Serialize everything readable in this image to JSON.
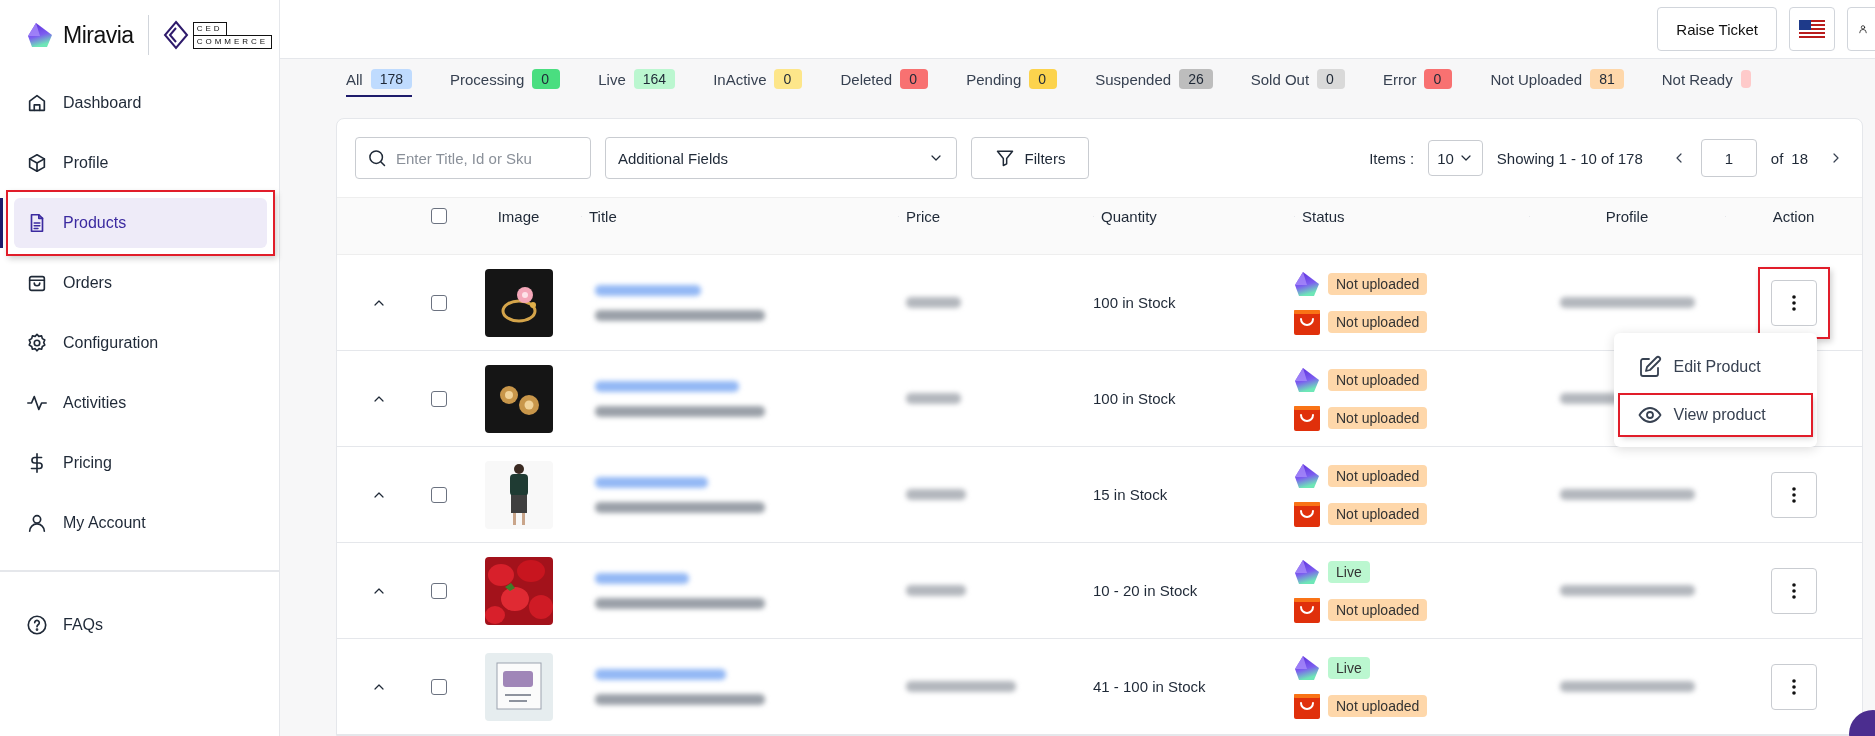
{
  "sidebar": {
    "logo": {
      "brand": "Miravia",
      "partner_top": "CED",
      "partner_bottom": "COMMERCE"
    },
    "items": [
      {
        "label": "Dashboard",
        "selected": false,
        "highlighted": false
      },
      {
        "label": "Profile",
        "selected": false,
        "highlighted": false
      },
      {
        "label": "Products",
        "selected": true,
        "highlighted": true
      },
      {
        "label": "Orders",
        "selected": false,
        "highlighted": false
      },
      {
        "label": "Configuration",
        "selected": false,
        "highlighted": false
      },
      {
        "label": "Activities",
        "selected": false,
        "highlighted": false
      },
      {
        "label": "Pricing",
        "selected": false,
        "highlighted": false
      },
      {
        "label": "My Account",
        "selected": false,
        "highlighted": false
      }
    ],
    "footer_items": [
      {
        "label": "FAQs",
        "selected": false,
        "highlighted": false
      }
    ]
  },
  "header": {
    "buttons": [
      "Raise Ticket"
    ]
  },
  "status_tabs": [
    {
      "label": "All",
      "count": "178",
      "color": "#bfdbfe",
      "selected": true
    },
    {
      "label": "Processing",
      "count": "0",
      "color": "#4ade80",
      "selected": false
    },
    {
      "label": "Live",
      "count": "164",
      "color": "#bbf7d0",
      "selected": false
    },
    {
      "label": "InActive",
      "count": "0",
      "color": "#fde68a",
      "selected": false
    },
    {
      "label": "Deleted",
      "count": "0",
      "color": "#f87171",
      "selected": false
    },
    {
      "label": "Pending",
      "count": "0",
      "color": "#fcd34d",
      "selected": false
    },
    {
      "label": "Suspended",
      "count": "26",
      "color": "#bdbdbd",
      "selected": false
    },
    {
      "label": "Sold Out",
      "count": "0",
      "color": "#d9d9d9",
      "selected": false
    },
    {
      "label": "Error",
      "count": "0",
      "color": "#f87171",
      "selected": false
    },
    {
      "label": "Not Uploaded",
      "count": "81",
      "color": "#fed7aa",
      "selected": false
    },
    {
      "label": "Not Ready",
      "color": "#fecaca",
      "selected": false
    }
  ],
  "toolbar": {
    "search": {
      "placeholder": "Enter Title, Id or Sku"
    },
    "fields_select": "Additional Fields",
    "filters_button": "Filters",
    "items_label": "Items :",
    "items_per_page": "10",
    "showing": "Showing 1 - 10 of 178",
    "page": "1",
    "of_label": "of",
    "total_pages": "18"
  },
  "table": {
    "select_all": {
      "checked": false
    },
    "columns": [
      "Image",
      "Title",
      "Price",
      "Quantity",
      "Status",
      "Profile",
      "Action"
    ],
    "rows": [
      {
        "checked": false,
        "quantity": "100 in Stock",
        "statuses": [
          {
            "kind": "miravia",
            "label": "Not uploaded",
            "color": "#fed7aa"
          },
          {
            "kind": "shop",
            "label": "Not uploaded",
            "color": "#fed7aa"
          }
        ],
        "action_highlighted": true,
        "action_menu": [
          {
            "label": "Edit Product",
            "highlighted": false
          },
          {
            "label": "View product",
            "highlighted": true
          }
        ]
      },
      {
        "checked": false,
        "quantity": "100 in Stock",
        "statuses": [
          {
            "kind": "miravia",
            "label": "Not uploaded",
            "color": "#fed7aa"
          },
          {
            "kind": "shop",
            "label": "Not uploaded",
            "color": "#fed7aa"
          }
        ]
      },
      {
        "checked": false,
        "quantity": "15 in Stock",
        "statuses": [
          {
            "kind": "miravia",
            "label": "Not uploaded",
            "color": "#fed7aa"
          },
          {
            "kind": "shop",
            "label": "Not uploaded",
            "color": "#fed7aa"
          }
        ],
        "action_highlighted": false
      },
      {
        "checked": false,
        "quantity": "10 - 20 in Stock",
        "statuses": [
          {
            "kind": "miravia",
            "label": "Live",
            "color": "#bbf7d0"
          },
          {
            "kind": "shop",
            "label": "Not uploaded",
            "color": "#fed7aa"
          }
        ],
        "action_highlighted": false
      },
      {
        "checked": false,
        "quantity": "41 - 100 in Stock",
        "statuses": [
          {
            "kind": "miravia",
            "label": "Live",
            "color": "#bbf7d0"
          },
          {
            "kind": "shop",
            "label": "Not uploaded",
            "color": "#fed7aa"
          }
        ],
        "action_highlighted": false
      }
    ]
  }
}
